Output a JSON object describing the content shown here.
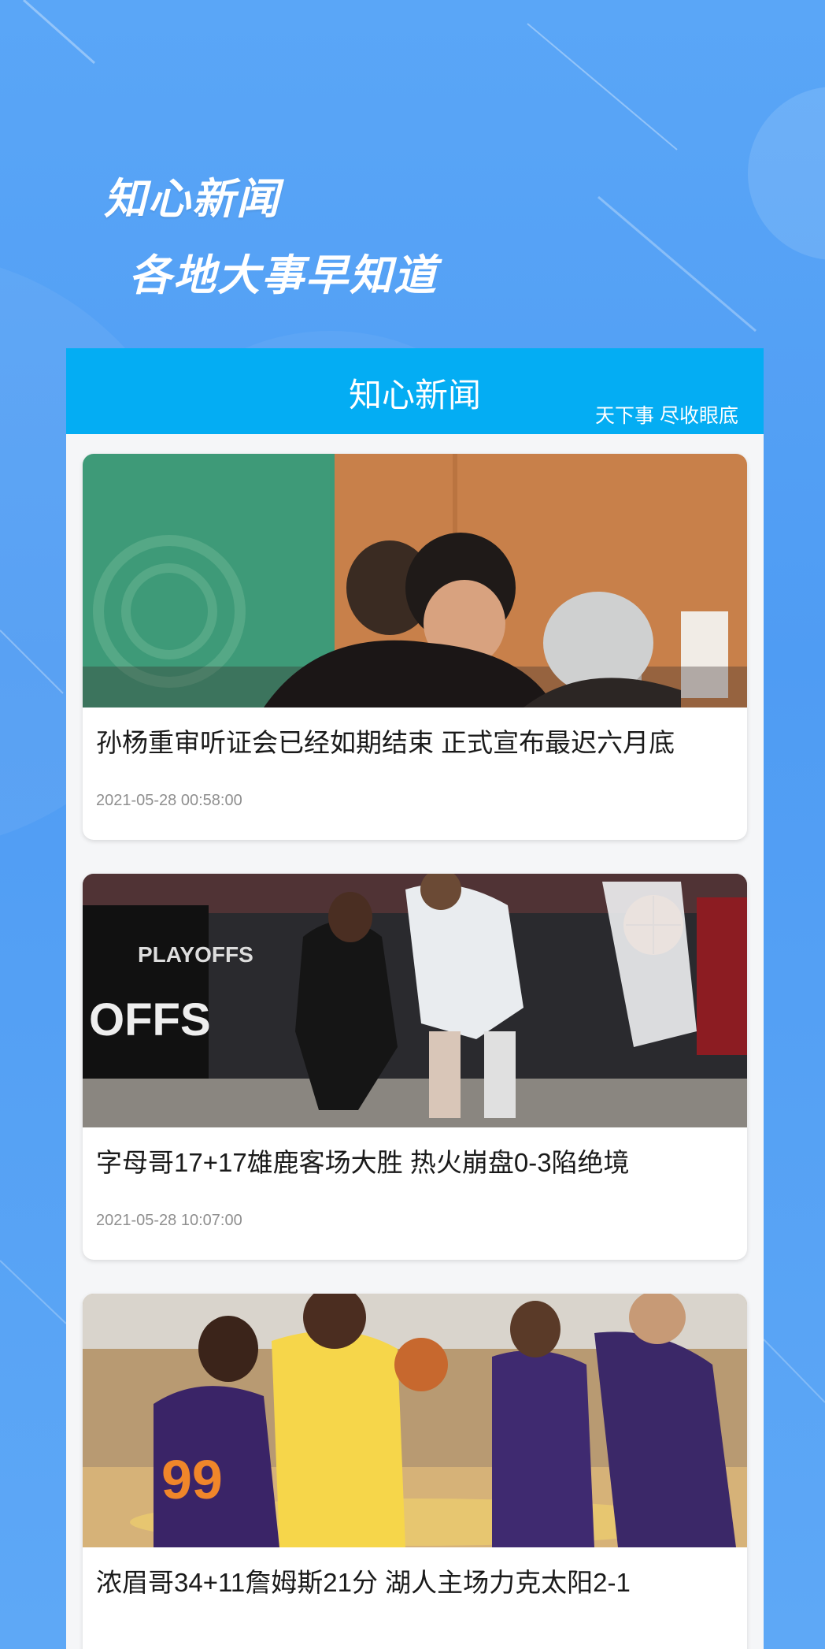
{
  "promo": {
    "title": "知心新闻",
    "subtitle": "各地大事早知道"
  },
  "app": {
    "header_title": "知心新闻",
    "slogan": "天下事 尽收眼底",
    "accent_color": "#04adf3"
  },
  "news": [
    {
      "title": "孙杨重审听证会已经如期结束 正式宣布最迟六月底",
      "time": "2021-05-28 00:58:00",
      "image": "hearing-room-photo"
    },
    {
      "title": "字母哥17+17雄鹿客场大胜 热火崩盘0-3陷绝境",
      "time": "2021-05-28 10:07:00",
      "image": "bucks-vs-heat-photo"
    },
    {
      "title": "浓眉哥34+11詹姆斯21分 湖人主场力克太阳2-1",
      "time": "",
      "image": "lakers-vs-suns-photo"
    }
  ]
}
